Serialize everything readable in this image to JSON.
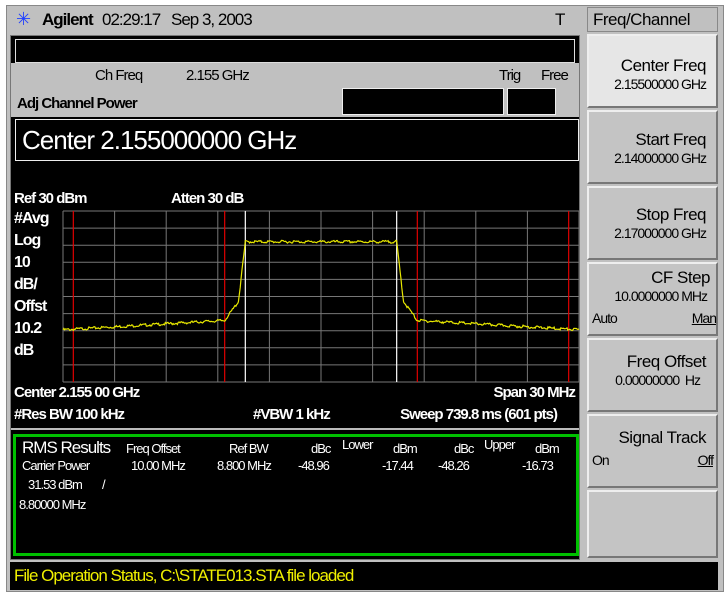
{
  "header": {
    "brand": "Agilent",
    "time": "02:29:17",
    "date": "Sep 3, 2003",
    "trigger_indicator": "T"
  },
  "info": {
    "ch_freq_label": "Ch Freq",
    "ch_freq_value": "2.155 GHz",
    "trig_label": "Trig",
    "trig_value": "Free",
    "measurement": "Adj Channel Power",
    "active_entry": "Center 2.155000000 GHz"
  },
  "chart_data": {
    "type": "line",
    "ref_label": "Ref 30 dBm",
    "atten_label": "Atten 30 dB",
    "left_labels": [
      "#Avg",
      "Log",
      "10",
      "dB/",
      "Offst",
      "10.2",
      "dB"
    ],
    "bottom_left": "Center 2.155 00 GHz",
    "bottom_right": "Span 30 MHz",
    "rbw": "#Res BW 100 kHz",
    "vbw": "#VBW 1 kHz",
    "sweep": "Sweep 739.8 ms (601 pts)",
    "xlim_ghz": [
      2.14,
      2.17
    ],
    "ylim_dbm": [
      -70,
      30
    ],
    "grid": true,
    "red_markers_ghz": [
      2.1406,
      2.1494,
      2.1606,
      2.1694
    ],
    "white_markers_ghz": [
      2.1506,
      2.1594
    ],
    "trace_color": "#e8e800",
    "trace": {
      "x_ghz": [
        2.14,
        2.1494,
        2.1502,
        2.1506,
        2.1594,
        2.1598,
        2.1606,
        2.17
      ],
      "y_dbm": [
        -39.5,
        -34,
        -23,
        12,
        12,
        -23,
        -34,
        -39.5
      ]
    }
  },
  "results": {
    "title": "RMS Results",
    "carrier_label": "Carrier Power",
    "carrier_power": "31.53 dBm",
    "slash": "/",
    "carrier_bw": "8.80000 MHz",
    "headers": {
      "freq_offset": "Freq Offset",
      "ref_bw": "Ref BW",
      "lower": "Lower",
      "upper": "Upper",
      "dbc": "dBc",
      "dbm": "dBm"
    },
    "row": {
      "freq_offset": "10.00 MHz",
      "ref_bw": "8.800 MHz",
      "lower_dbc": "-48.96",
      "lower_dbm": "-17.44",
      "upper_dbc": "-48.26",
      "upper_dbm": "-16.73"
    },
    "border_color": "#00c000"
  },
  "menu": {
    "title": "Freq/Channel",
    "keys": [
      {
        "label": "Center Freq",
        "value": "2.15500000 GHz"
      },
      {
        "label": "Start Freq",
        "value": "2.14000000 GHz"
      },
      {
        "label": "Stop Freq",
        "value": "2.17000000 GHz"
      },
      {
        "label": "CF Step",
        "value": "10.0000000 MHz",
        "opt_a": "Auto",
        "opt_b": "Man"
      },
      {
        "label": "Freq Offset",
        "value": "0.00000000  Hz"
      },
      {
        "label": "Signal Track",
        "opt_a": "On",
        "opt_b": "Off"
      }
    ]
  },
  "status": "File Operation Status, C:\\STATE013.STA file loaded"
}
